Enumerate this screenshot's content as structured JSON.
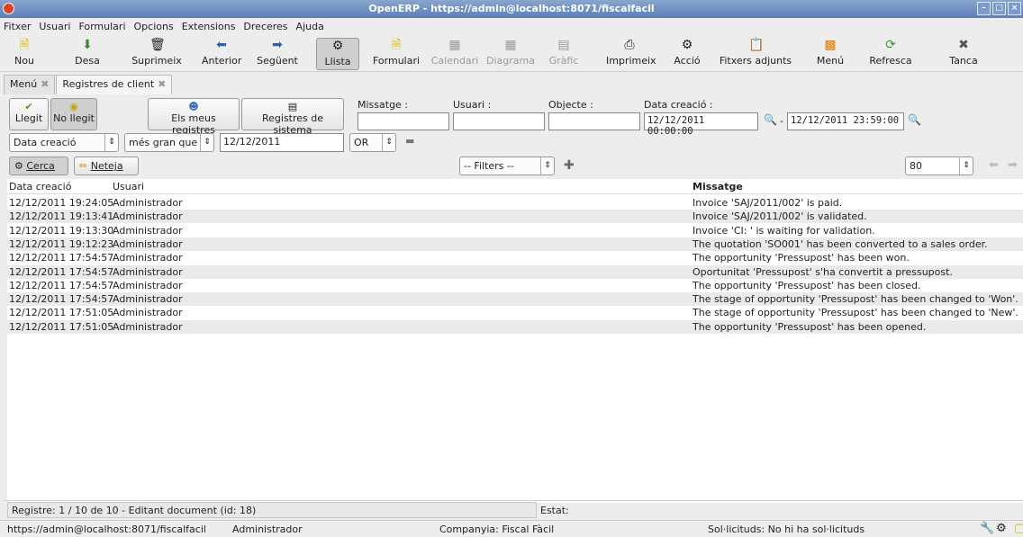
{
  "window": {
    "title": "OpenERP - https://admin@localhost:8071/fiscalfacil",
    "controls": [
      "minimize-icon",
      "maximize-icon",
      "close-icon"
    ]
  },
  "menubar": [
    "Fitxer",
    "Usuari",
    "Formulari",
    "Opcions",
    "Extensions",
    "Dreceres",
    "Ajuda"
  ],
  "toolbar": {
    "nou": "Nou",
    "desa": "Desa",
    "suprimeix": "Suprimeix",
    "anterior": "Anterior",
    "seguent": "Següent",
    "llista": "Llista",
    "formulari": "Formulari",
    "calendari": "Calendari",
    "diagrama": "Diagrama",
    "grafic": "Gràfic",
    "imprimeix": "Imprimeix",
    "accio": "Acció",
    "fitxers": "Fitxers adjunts",
    "menu": "Menú",
    "refresca": "Refresca",
    "tanca": "Tanca"
  },
  "tabs": {
    "menu": "Menú",
    "registres": "Registres de client"
  },
  "filters": {
    "llegit": "Llegit",
    "no_llegit": "No llegit",
    "meus": "Els meus registres",
    "sistema": "Registres de sistema",
    "missatge_label": "Missatge :",
    "usuari_label": "Usuari :",
    "objecte_label": "Objecte :",
    "data_label": "Data creació :",
    "missatge_value": "",
    "usuari_value": "",
    "objecte_value": "",
    "data_from": "12/12/2011 00:00:00",
    "data_sep": "-",
    "data_to": "12/12/2011 23:59:00",
    "adv_field": "Data creació",
    "adv_operator": "més gran que",
    "adv_value": "12/12/2011",
    "adv_logic": "OR",
    "cerca": "Cerca",
    "neteja": "Neteja",
    "filters_select": "-- Filters --",
    "limit": "80"
  },
  "table": {
    "columns": [
      "Data creació",
      "Usuari",
      "Missatge"
    ],
    "rows": [
      [
        "12/12/2011 19:24:05",
        "Administrador",
        "Invoice 'SAJ/2011/002' is paid."
      ],
      [
        "12/12/2011 19:13:41",
        "Administrador",
        "Invoice  'SAJ/2011/002' is validated."
      ],
      [
        "12/12/2011 19:13:30",
        "Administrador",
        "Invoice 'CI: ' is waiting for validation."
      ],
      [
        "12/12/2011 19:12:23",
        "Administrador",
        "The quotation 'SO001' has been converted to a sales order."
      ],
      [
        "12/12/2011 17:54:57",
        "Administrador",
        "The opportunity 'Pressupost' has been won."
      ],
      [
        "12/12/2011 17:54:57",
        "Administrador",
        "Oportunitat  'Pressupost' s'ha convertit a pressupost."
      ],
      [
        "12/12/2011 17:54:57",
        "Administrador",
        "The opportunity 'Pressupost' has been closed."
      ],
      [
        "12/12/2011 17:54:57",
        "Administrador",
        "The stage of opportunity 'Pressupost' has been changed to 'Won'."
      ],
      [
        "12/12/2011 17:51:05",
        "Administrador",
        "The stage of opportunity 'Pressupost' has been changed to 'New'."
      ],
      [
        "12/12/2011 17:51:05",
        "Administrador",
        "The opportunity 'Pressupost' has been opened."
      ]
    ]
  },
  "status": {
    "registre": "Registre: 1 / 10 de 10 - Editant document (id: 18)",
    "estat": "Estat:",
    "url": "https://admin@localhost:8071/fiscalfacil",
    "user": "Administrador",
    "company": "Companyia:  Fiscal Fàcil",
    "requests": "Sol·licituds:  No hi ha sol·licituds"
  }
}
